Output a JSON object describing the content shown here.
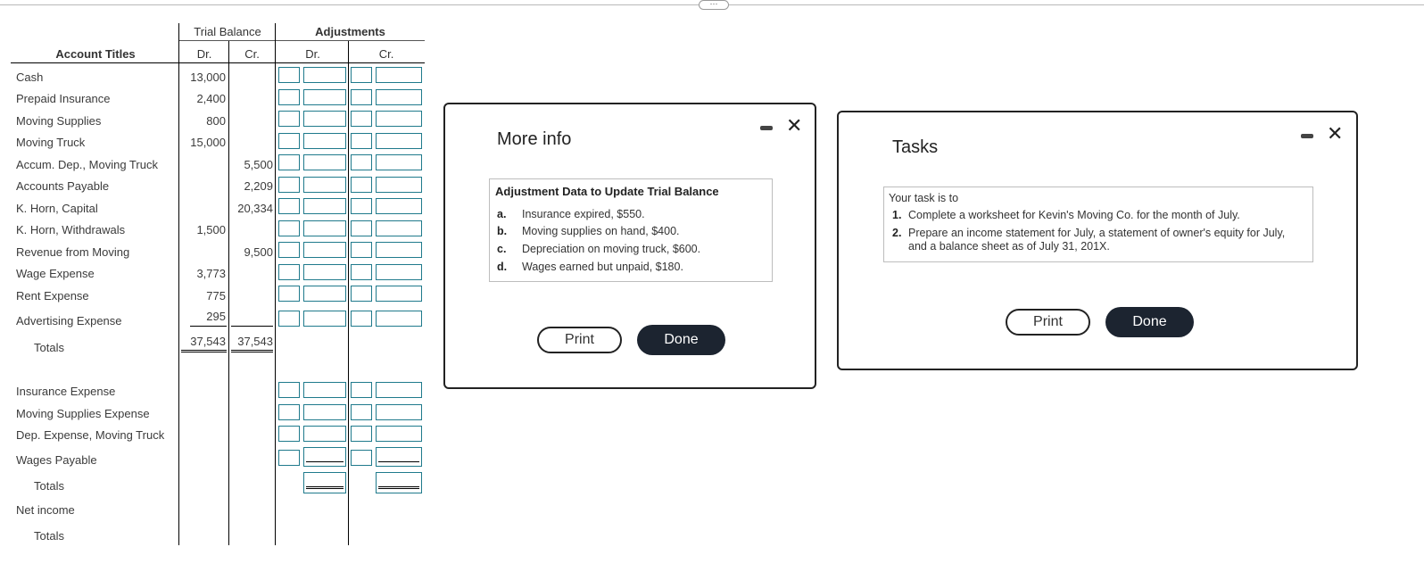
{
  "handle": "⋯",
  "worksheet": {
    "headers": {
      "account_titles": "Account Titles",
      "trial_balance": "Trial Balance",
      "adjustments": "Adjustments",
      "dr": "Dr.",
      "cr": "Cr."
    },
    "rows": [
      {
        "label": "Cash",
        "dr": "13,000",
        "cr": ""
      },
      {
        "label": "Prepaid Insurance",
        "dr": "2,400",
        "cr": ""
      },
      {
        "label": "Moving Supplies",
        "dr": "800",
        "cr": ""
      },
      {
        "label": "Moving Truck",
        "dr": "15,000",
        "cr": ""
      },
      {
        "label": "Accum. Dep., Moving Truck",
        "dr": "",
        "cr": "5,500"
      },
      {
        "label": "Accounts Payable",
        "dr": "",
        "cr": "2,209"
      },
      {
        "label": "K. Horn, Capital",
        "dr": "",
        "cr": "20,334"
      },
      {
        "label": "K. Horn, Withdrawals",
        "dr": "1,500",
        "cr": ""
      },
      {
        "label": "Revenue from Moving",
        "dr": "",
        "cr": "9,500"
      },
      {
        "label": "Wage Expense",
        "dr": "3,773",
        "cr": ""
      },
      {
        "label": "Rent Expense",
        "dr": "775",
        "cr": ""
      },
      {
        "label": "Advertising Expense",
        "dr": "295",
        "cr": ""
      }
    ],
    "totals_label": "Totals",
    "totals_dr": "37,543",
    "totals_cr": "37,543",
    "extra_rows": [
      "Insurance Expense",
      "Moving Supplies Expense",
      "Dep. Expense, Moving Truck",
      "Wages Payable"
    ],
    "totals2_label": "Totals",
    "net_income_label": "Net income",
    "totals3_label": "Totals"
  },
  "more_info": {
    "title": "More info",
    "box_title": "Adjustment Data to Update Trial Balance",
    "items": [
      {
        "key": "a.",
        "text": "Insurance expired, $550."
      },
      {
        "key": "b.",
        "text": "Moving supplies on hand, $400."
      },
      {
        "key": "c.",
        "text": "Depreciation on moving truck, $600."
      },
      {
        "key": "d.",
        "text": "Wages earned but unpaid, $180."
      }
    ],
    "print_label": "Print",
    "done_label": "Done"
  },
  "tasks": {
    "title": "Tasks",
    "intro": "Your task is to",
    "items": [
      {
        "key": "1.",
        "text": "Complete a worksheet for Kevin's Moving Co. for the month of July."
      },
      {
        "key": "2.",
        "text": "Prepare an income statement for July, a statement of owner's equity for July,",
        "text2": "and a balance sheet as of July 31, 201X."
      }
    ],
    "print_label": "Print",
    "done_label": "Done"
  }
}
